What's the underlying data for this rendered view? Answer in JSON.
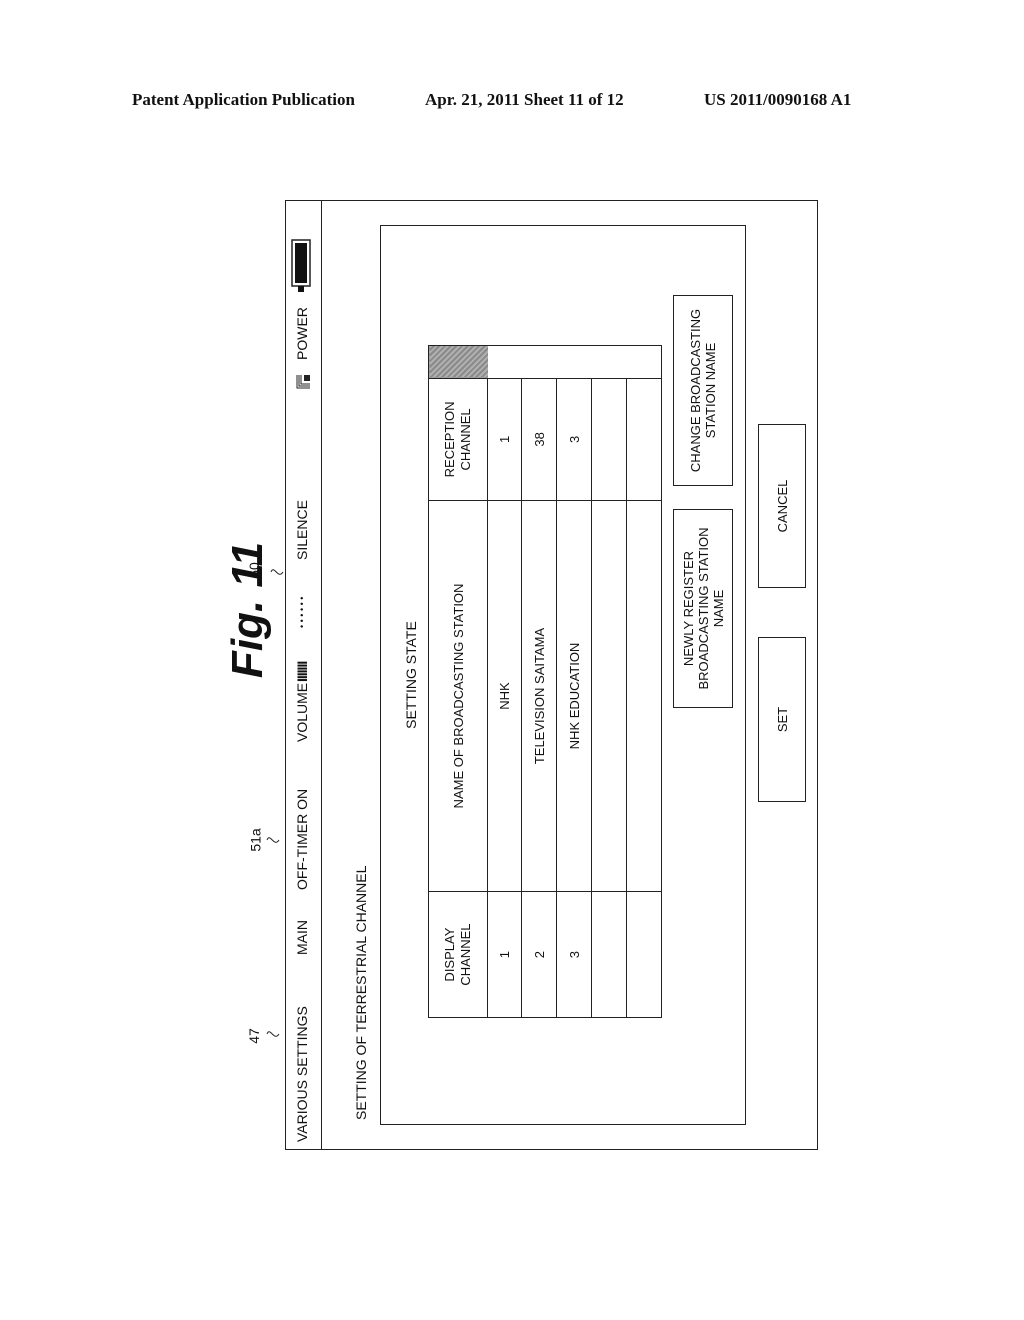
{
  "header": {
    "publication": "Patent Application Publication",
    "date_sheet": "Apr. 21, 2011  Sheet 11 of 12",
    "number": "US 2011/0090168 A1"
  },
  "figure": {
    "title": "Fig. 11",
    "refs": {
      "statusbar_ref": "47",
      "offtimer_ref": "51a",
      "volume_ref": "60"
    }
  },
  "statusbar": {
    "section": "VARIOUS SETTINGS",
    "mode": "MAIN",
    "timer": "OFF-TIMER ON",
    "volume_label": "VOLUME",
    "volume_bars": "IIIIIII",
    "silence_dots": "• • • • • •",
    "silence_label": "SILENCE",
    "speaker_icon": "speaker-icon",
    "power_label": "POWER",
    "power_icon": "power-indicator-icon"
  },
  "screen": {
    "title": "SETTING OF TERRESTRIAL CHANNEL",
    "panel_title": "SETTING STATE",
    "table": {
      "columns": [
        "DISPLAY CHANNEL",
        "NAME OF BROADCASTING STATION",
        "RECEPTION CHANNEL"
      ],
      "col_display": "DISPLAY\nCHANNEL",
      "col_name": "NAME OF BROADCASTING STATION",
      "col_reception": "RECEPTION\nCHANNEL",
      "rows": [
        {
          "display": "1",
          "name": "NHK",
          "reception": "1"
        },
        {
          "display": "2",
          "name": "TELEVISION SAITAMA",
          "reception": "38"
        },
        {
          "display": "3",
          "name": "NHK EDUCATION",
          "reception": "3"
        },
        {
          "display": "",
          "name": "",
          "reception": ""
        },
        {
          "display": "",
          "name": "",
          "reception": ""
        }
      ]
    },
    "buttons": {
      "register": "NEWLY REGISTER BROADCASTING STATION NAME",
      "change": "CHANGE BROADCASTING STATION NAME",
      "set": "SET",
      "cancel": "CANCEL"
    }
  }
}
